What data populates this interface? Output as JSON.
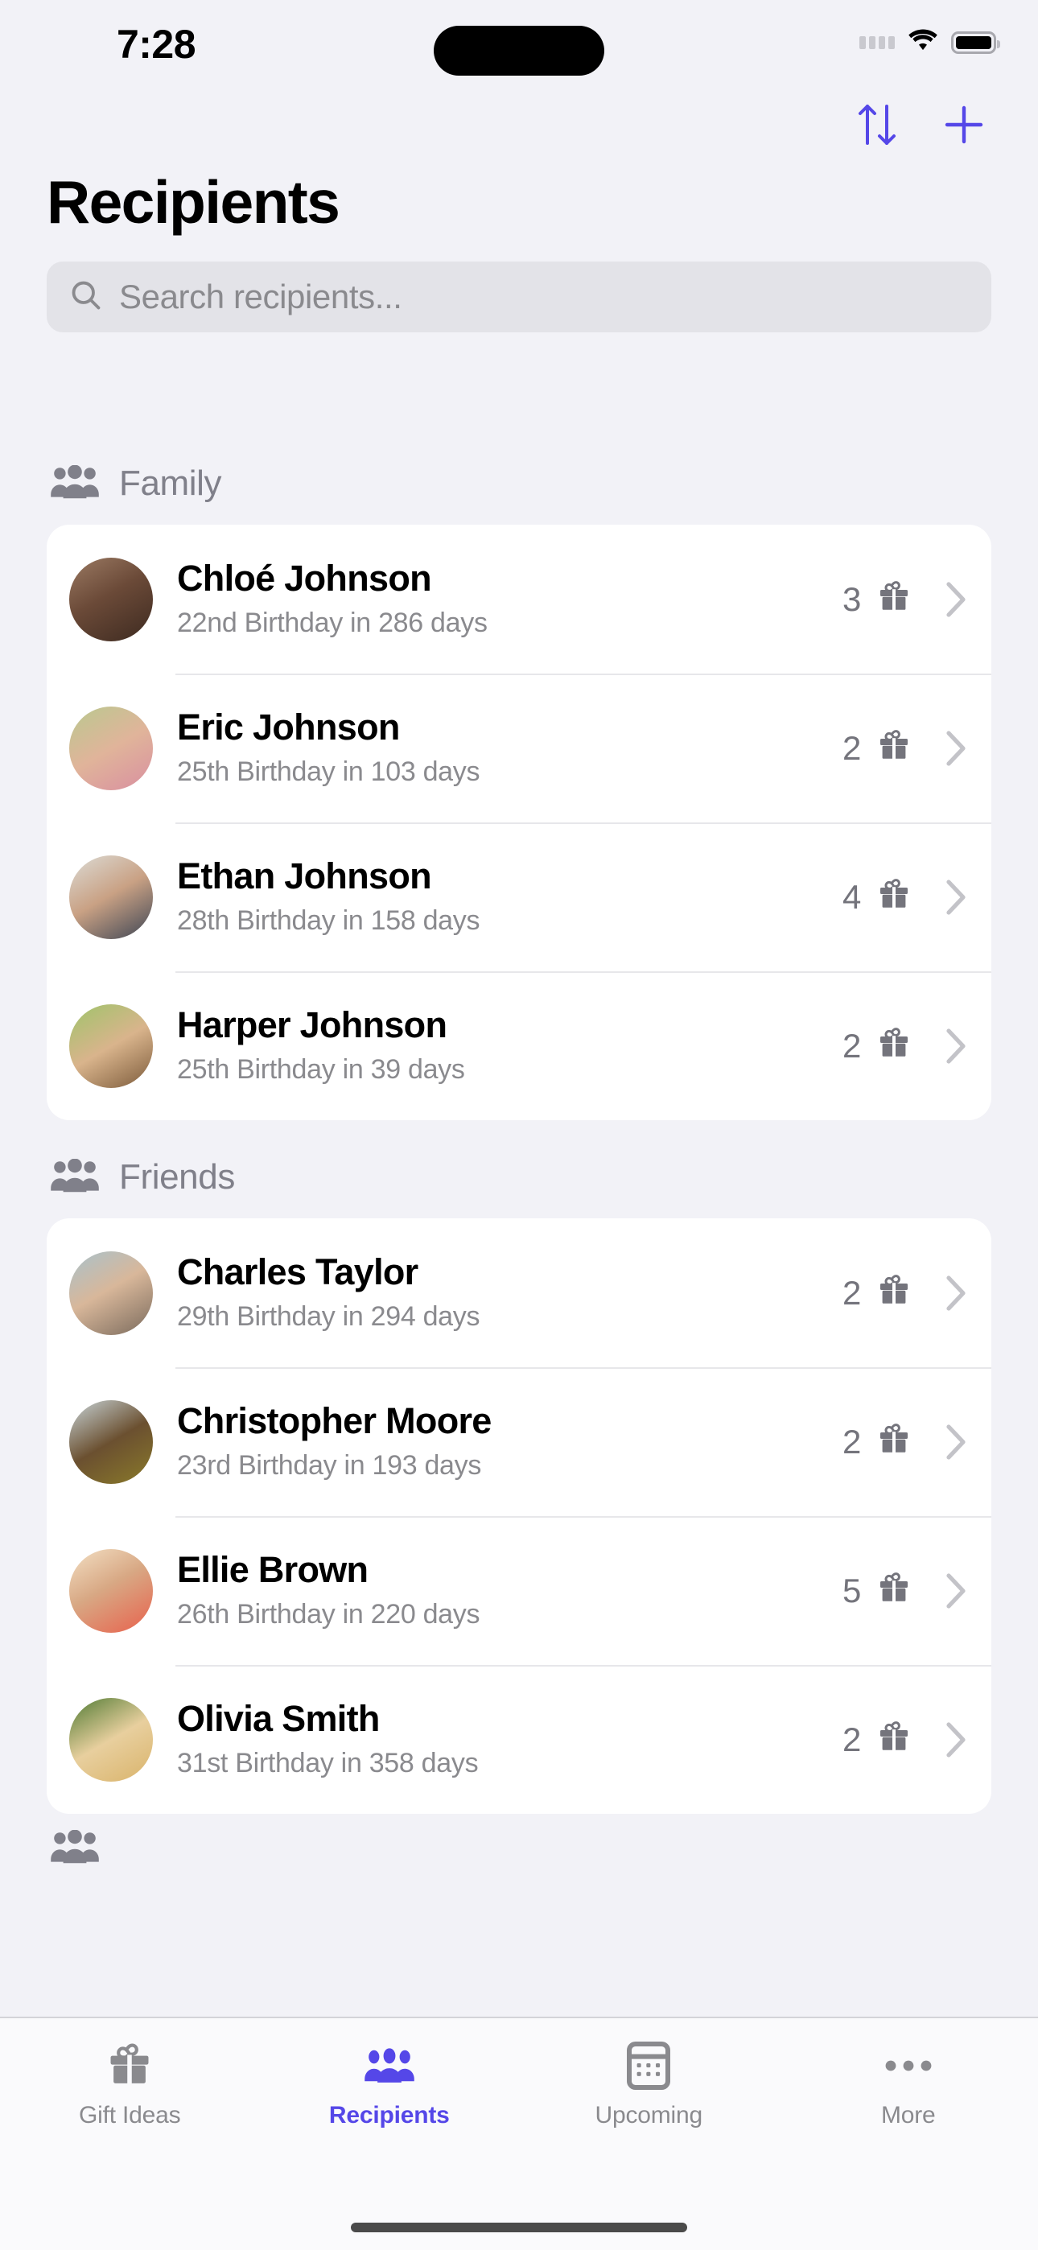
{
  "status_bar": {
    "time": "7:28",
    "cellular_icon": "cellular-dots-icon",
    "wifi_icon": "wifi-icon",
    "battery_icon": "battery-icon"
  },
  "nav": {
    "sort_icon": "sort-arrows-icon",
    "add_icon": "plus-icon",
    "accent_color": "#5547e8"
  },
  "header": {
    "title": "Recipients"
  },
  "search": {
    "placeholder": "Search recipients...",
    "icon": "search-icon"
  },
  "sections": [
    {
      "title": "Family",
      "icon": "group-people-icon",
      "rows": [
        {
          "name": "Chloé Johnson",
          "subtitle": "22nd Birthday in 286 days",
          "gift_count": "3",
          "gift_icon": "gift-icon",
          "chevron_icon": "chevron-right-icon",
          "avatar": "avatar-chloe-johnson",
          "avatar_colors": [
            "#8c6a56",
            "#c9a98e",
            "#5b4034"
          ]
        },
        {
          "name": "Eric Johnson",
          "subtitle": "25th Birthday in 103 days",
          "gift_count": "2",
          "gift_icon": "gift-icon",
          "chevron_icon": "chevron-right-icon",
          "avatar": "avatar-eric-johnson",
          "avatar_colors": [
            "#b9c98f",
            "#e0b49a",
            "#d98fa0"
          ]
        },
        {
          "name": "Ethan Johnson",
          "subtitle": "28th Birthday in 158 days",
          "gift_count": "4",
          "gift_icon": "gift-icon",
          "chevron_icon": "chevron-right-icon",
          "avatar": "avatar-ethan-johnson",
          "avatar_colors": [
            "#dcdcd6",
            "#c9a184",
            "#3d4554"
          ]
        },
        {
          "name": "Harper Johnson",
          "subtitle": "25th Birthday in 39 days",
          "gift_count": "2",
          "gift_icon": "gift-icon",
          "chevron_icon": "chevron-right-icon",
          "avatar": "avatar-harper-johnson",
          "avatar_colors": [
            "#9ec46a",
            "#d9b48c",
            "#7b5a3a"
          ]
        }
      ]
    },
    {
      "title": "Friends",
      "icon": "group-people-icon",
      "rows": [
        {
          "name": "Charles Taylor",
          "subtitle": "29th Birthday in 294 days",
          "gift_count": "2",
          "gift_icon": "gift-icon",
          "chevron_icon": "chevron-right-icon",
          "avatar": "avatar-charles-taylor",
          "avatar_colors": [
            "#a8c2cc",
            "#d8b79a",
            "#7a6a5c"
          ]
        },
        {
          "name": "Christopher Moore",
          "subtitle": "23rd Birthday in 193 days",
          "gift_count": "2",
          "gift_icon": "gift-icon",
          "chevron_icon": "chevron-right-icon",
          "avatar": "avatar-christopher-moore",
          "avatar_colors": [
            "#c8d4d8",
            "#6b5030",
            "#8a7a2a"
          ]
        },
        {
          "name": "Ellie Brown",
          "subtitle": "26th Birthday in 220 days",
          "gift_count": "5",
          "gift_icon": "gift-icon",
          "chevron_icon": "chevron-right-icon",
          "avatar": "avatar-ellie-brown",
          "avatar_colors": [
            "#f3e0c4",
            "#d8a884",
            "#e8614c"
          ]
        },
        {
          "name": "Olivia Smith",
          "subtitle": "31st Birthday in 358 days",
          "gift_count": "2",
          "gift_icon": "gift-icon",
          "chevron_icon": "chevron-right-icon",
          "avatar": "avatar-olivia-smith",
          "avatar_colors": [
            "#4f7a33",
            "#e8cf9e",
            "#d9b36a"
          ]
        }
      ]
    }
  ],
  "tabbar": {
    "items": [
      {
        "label": "Gift Ideas",
        "icon": "gift-icon",
        "active": false
      },
      {
        "label": "Recipients",
        "icon": "group-people-icon",
        "active": true
      },
      {
        "label": "Upcoming",
        "icon": "calendar-icon",
        "active": false
      },
      {
        "label": "More",
        "icon": "ellipsis-icon",
        "active": false
      }
    ],
    "active_color": "#5547e8",
    "inactive_color": "#8a8a8e"
  }
}
